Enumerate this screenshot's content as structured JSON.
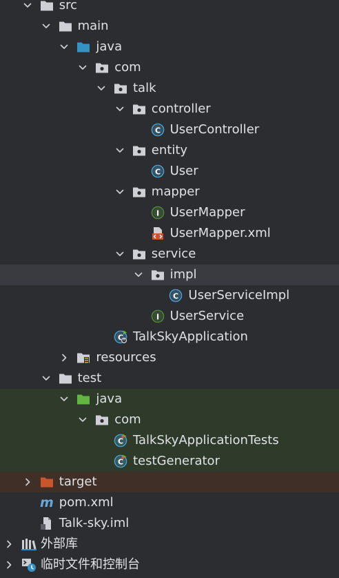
{
  "project_tree": {
    "nodes": [
      {
        "key": "src",
        "label": "src",
        "depth": 1,
        "toggle": "expanded",
        "icon": "folder-icon"
      },
      {
        "key": "main",
        "label": "main",
        "depth": 2,
        "toggle": "expanded",
        "icon": "folder-icon"
      },
      {
        "key": "java-main",
        "label": "java",
        "depth": 3,
        "toggle": "expanded",
        "icon": "source-root-folder-icon"
      },
      {
        "key": "com-main",
        "label": "com",
        "depth": 4,
        "toggle": "expanded",
        "icon": "package-icon"
      },
      {
        "key": "talk",
        "label": "talk",
        "depth": 5,
        "toggle": "expanded",
        "icon": "package-icon"
      },
      {
        "key": "controller",
        "label": "controller",
        "depth": 6,
        "toggle": "expanded",
        "icon": "package-icon"
      },
      {
        "key": "user-controller",
        "label": "UserController",
        "depth": 7,
        "toggle": "none",
        "icon": "java-class-icon"
      },
      {
        "key": "entity",
        "label": "entity",
        "depth": 6,
        "toggle": "expanded",
        "icon": "package-icon"
      },
      {
        "key": "user",
        "label": "User",
        "depth": 7,
        "toggle": "none",
        "icon": "java-class-icon"
      },
      {
        "key": "mapper",
        "label": "mapper",
        "depth": 6,
        "toggle": "expanded",
        "icon": "package-icon"
      },
      {
        "key": "user-mapper",
        "label": "UserMapper",
        "depth": 7,
        "toggle": "none",
        "icon": "java-interface-icon"
      },
      {
        "key": "user-mapper-xml",
        "label": "UserMapper.xml",
        "depth": 7,
        "toggle": "none",
        "icon": "xml-file-icon"
      },
      {
        "key": "service",
        "label": "service",
        "depth": 6,
        "toggle": "expanded",
        "icon": "package-icon"
      },
      {
        "key": "impl",
        "label": "impl",
        "depth": 7,
        "toggle": "expanded",
        "icon": "package-icon",
        "selected": true
      },
      {
        "key": "user-service-impl",
        "label": "UserServiceImpl",
        "depth": 8,
        "toggle": "none",
        "icon": "java-class-icon"
      },
      {
        "key": "user-service",
        "label": "UserService",
        "depth": 7,
        "toggle": "none",
        "icon": "java-interface-icon"
      },
      {
        "key": "talk-sky-application",
        "label": "TalkSkyApplication",
        "depth": 5,
        "toggle": "none",
        "icon": "spring-boot-application-icon"
      },
      {
        "key": "resources",
        "label": "resources",
        "depth": 3,
        "toggle": "collapsed",
        "icon": "resources-folder-icon"
      },
      {
        "key": "test",
        "label": "test",
        "depth": 2,
        "toggle": "expanded",
        "icon": "folder-icon"
      },
      {
        "key": "java-test",
        "label": "java",
        "depth": 3,
        "toggle": "expanded",
        "icon": "test-source-folder-icon",
        "highlight": "test"
      },
      {
        "key": "com-test",
        "label": "com",
        "depth": 4,
        "toggle": "expanded",
        "icon": "package-icon",
        "highlight": "test"
      },
      {
        "key": "talk-sky-application-tests",
        "label": "TalkSkyApplicationTests",
        "depth": 5,
        "toggle": "none",
        "icon": "test-class-icon",
        "highlight": "test"
      },
      {
        "key": "test-generator",
        "label": "testGenerator",
        "depth": 5,
        "toggle": "none",
        "icon": "test-class-icon",
        "highlight": "test"
      },
      {
        "key": "target",
        "label": "target",
        "depth": 1,
        "toggle": "collapsed",
        "icon": "excluded-folder-icon",
        "highlight": "excluded"
      },
      {
        "key": "pom-xml",
        "label": "pom.xml",
        "depth": 1,
        "toggle": "none",
        "icon": "maven-icon"
      },
      {
        "key": "talk-sky-iml",
        "label": "Talk-sky.iml",
        "depth": 1,
        "toggle": "none",
        "icon": "iml-file-icon"
      },
      {
        "key": "external-libraries",
        "label": "外部库",
        "depth": 0,
        "toggle": "collapsed",
        "icon": "library-icon"
      },
      {
        "key": "scratches-and-consoles",
        "label": "临时文件和控制台",
        "depth": 0,
        "toggle": "collapsed",
        "icon": "scratches-icon"
      }
    ]
  },
  "colors": {
    "background": "#2b2d30",
    "selected_row": "#393b40",
    "test_row": "#2e3b2a",
    "excluded_row": "#3f2f27",
    "text": "#dfe1e5",
    "chevron": "#ced0d6",
    "folder_gray": "#ced0d6",
    "source_root_blue": "#3592c4",
    "test_root_green": "#62b543",
    "excluded_orange": "#c9562a",
    "class_blue": "#4a9fd1",
    "interface_green": "#4f8a3a"
  }
}
